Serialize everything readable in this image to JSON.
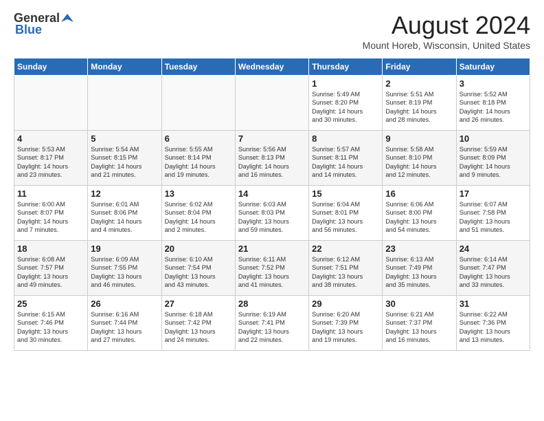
{
  "header": {
    "logo_general": "General",
    "logo_blue": "Blue",
    "month": "August 2024",
    "location": "Mount Horeb, Wisconsin, United States"
  },
  "weekdays": [
    "Sunday",
    "Monday",
    "Tuesday",
    "Wednesday",
    "Thursday",
    "Friday",
    "Saturday"
  ],
  "weeks": [
    [
      {
        "day": "",
        "content": ""
      },
      {
        "day": "",
        "content": ""
      },
      {
        "day": "",
        "content": ""
      },
      {
        "day": "",
        "content": ""
      },
      {
        "day": "1",
        "content": "Sunrise: 5:49 AM\nSunset: 8:20 PM\nDaylight: 14 hours\nand 30 minutes."
      },
      {
        "day": "2",
        "content": "Sunrise: 5:51 AM\nSunset: 8:19 PM\nDaylight: 14 hours\nand 28 minutes."
      },
      {
        "day": "3",
        "content": "Sunrise: 5:52 AM\nSunset: 8:18 PM\nDaylight: 14 hours\nand 26 minutes."
      }
    ],
    [
      {
        "day": "4",
        "content": "Sunrise: 5:53 AM\nSunset: 8:17 PM\nDaylight: 14 hours\nand 23 minutes."
      },
      {
        "day": "5",
        "content": "Sunrise: 5:54 AM\nSunset: 8:15 PM\nDaylight: 14 hours\nand 21 minutes."
      },
      {
        "day": "6",
        "content": "Sunrise: 5:55 AM\nSunset: 8:14 PM\nDaylight: 14 hours\nand 19 minutes."
      },
      {
        "day": "7",
        "content": "Sunrise: 5:56 AM\nSunset: 8:13 PM\nDaylight: 14 hours\nand 16 minutes."
      },
      {
        "day": "8",
        "content": "Sunrise: 5:57 AM\nSunset: 8:11 PM\nDaylight: 14 hours\nand 14 minutes."
      },
      {
        "day": "9",
        "content": "Sunrise: 5:58 AM\nSunset: 8:10 PM\nDaylight: 14 hours\nand 12 minutes."
      },
      {
        "day": "10",
        "content": "Sunrise: 5:59 AM\nSunset: 8:09 PM\nDaylight: 14 hours\nand 9 minutes."
      }
    ],
    [
      {
        "day": "11",
        "content": "Sunrise: 6:00 AM\nSunset: 8:07 PM\nDaylight: 14 hours\nand 7 minutes."
      },
      {
        "day": "12",
        "content": "Sunrise: 6:01 AM\nSunset: 8:06 PM\nDaylight: 14 hours\nand 4 minutes."
      },
      {
        "day": "13",
        "content": "Sunrise: 6:02 AM\nSunset: 8:04 PM\nDaylight: 14 hours\nand 2 minutes."
      },
      {
        "day": "14",
        "content": "Sunrise: 6:03 AM\nSunset: 8:03 PM\nDaylight: 13 hours\nand 59 minutes."
      },
      {
        "day": "15",
        "content": "Sunrise: 6:04 AM\nSunset: 8:01 PM\nDaylight: 13 hours\nand 56 minutes."
      },
      {
        "day": "16",
        "content": "Sunrise: 6:06 AM\nSunset: 8:00 PM\nDaylight: 13 hours\nand 54 minutes."
      },
      {
        "day": "17",
        "content": "Sunrise: 6:07 AM\nSunset: 7:58 PM\nDaylight: 13 hours\nand 51 minutes."
      }
    ],
    [
      {
        "day": "18",
        "content": "Sunrise: 6:08 AM\nSunset: 7:57 PM\nDaylight: 13 hours\nand 49 minutes."
      },
      {
        "day": "19",
        "content": "Sunrise: 6:09 AM\nSunset: 7:55 PM\nDaylight: 13 hours\nand 46 minutes."
      },
      {
        "day": "20",
        "content": "Sunrise: 6:10 AM\nSunset: 7:54 PM\nDaylight: 13 hours\nand 43 minutes."
      },
      {
        "day": "21",
        "content": "Sunrise: 6:11 AM\nSunset: 7:52 PM\nDaylight: 13 hours\nand 41 minutes."
      },
      {
        "day": "22",
        "content": "Sunrise: 6:12 AM\nSunset: 7:51 PM\nDaylight: 13 hours\nand 38 minutes."
      },
      {
        "day": "23",
        "content": "Sunrise: 6:13 AM\nSunset: 7:49 PM\nDaylight: 13 hours\nand 35 minutes."
      },
      {
        "day": "24",
        "content": "Sunrise: 6:14 AM\nSunset: 7:47 PM\nDaylight: 13 hours\nand 33 minutes."
      }
    ],
    [
      {
        "day": "25",
        "content": "Sunrise: 6:15 AM\nSunset: 7:46 PM\nDaylight: 13 hours\nand 30 minutes."
      },
      {
        "day": "26",
        "content": "Sunrise: 6:16 AM\nSunset: 7:44 PM\nDaylight: 13 hours\nand 27 minutes."
      },
      {
        "day": "27",
        "content": "Sunrise: 6:18 AM\nSunset: 7:42 PM\nDaylight: 13 hours\nand 24 minutes."
      },
      {
        "day": "28",
        "content": "Sunrise: 6:19 AM\nSunset: 7:41 PM\nDaylight: 13 hours\nand 22 minutes."
      },
      {
        "day": "29",
        "content": "Sunrise: 6:20 AM\nSunset: 7:39 PM\nDaylight: 13 hours\nand 19 minutes."
      },
      {
        "day": "30",
        "content": "Sunrise: 6:21 AM\nSunset: 7:37 PM\nDaylight: 13 hours\nand 16 minutes."
      },
      {
        "day": "31",
        "content": "Sunrise: 6:22 AM\nSunset: 7:36 PM\nDaylight: 13 hours\nand 13 minutes."
      }
    ]
  ]
}
